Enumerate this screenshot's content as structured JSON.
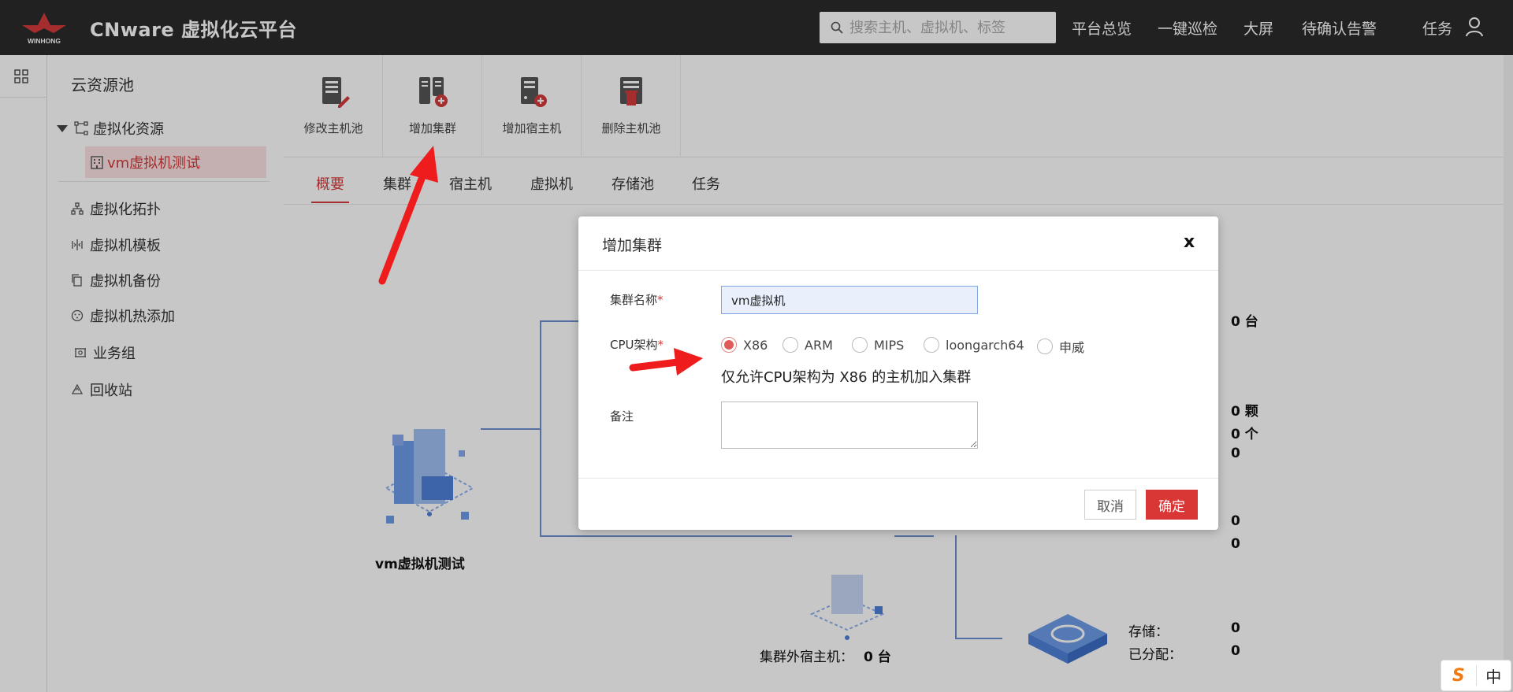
{
  "header": {
    "title": "CNware 虚拟化云平台",
    "logo_text": "WINHONG",
    "search_placeholder": "搜索主机、虚拟机、标签",
    "nav": [
      "平台总览",
      "一键巡检",
      "大屏",
      "待确认告警",
      "任务"
    ]
  },
  "sidebar": {
    "title": "云资源池",
    "tree_parent": "虚拟化资源",
    "tree_child": "vm虚拟机测试",
    "items": [
      "虚拟化拓扑",
      "虚拟机模板",
      "虚拟机备份",
      "虚拟机热添加",
      "业务组",
      "回收站"
    ]
  },
  "toolbar": {
    "items": [
      "修改主机池",
      "增加集群",
      "增加宿主机",
      "删除主机池"
    ]
  },
  "tabs": [
    "概要",
    "集群",
    "宿主机",
    "虚拟机",
    "存储池",
    "任务"
  ],
  "topology": {
    "pool_name": "vm虚拟机测试",
    "outside_host_label": "集群外宿主机：",
    "outside_host_value": "0 台",
    "stat_top": "0 台",
    "stats_mid": [
      "0 颗",
      "0 个",
      "0"
    ],
    "stats_low": [
      "0",
      "0"
    ],
    "storage_label": "存储：",
    "storage_value": "0",
    "allocated_label": "已分配：",
    "allocated_value": "0"
  },
  "dialog": {
    "title": "增加集群",
    "close": "x",
    "name_label": "集群名称",
    "name_value": "vm虚拟机",
    "cpu_label": "CPU架构",
    "required": "*",
    "cpu_options": [
      "X86",
      "ARM",
      "MIPS",
      "loongarch64",
      "申威"
    ],
    "cpu_selected": "X86",
    "hint": "仅允许CPU架构为 X86 的主机加入集群",
    "note_label": "备注",
    "cancel": "取消",
    "ok": "确定"
  },
  "ime": {
    "mode": "中"
  },
  "colors": {
    "accent": "#d43a3a",
    "header_bg": "#2b2b2b",
    "arrow": "#ee1c1c"
  }
}
